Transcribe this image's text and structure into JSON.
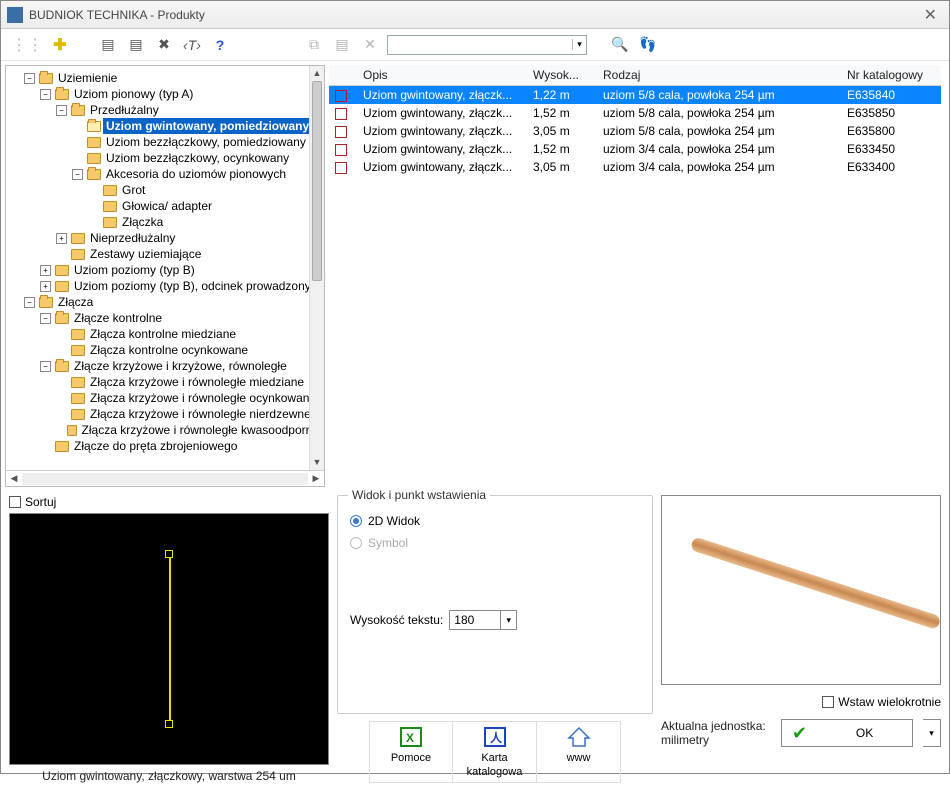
{
  "window": {
    "title": "BUDNIOK TECHNIKA - Produkty"
  },
  "toolbar": {
    "search_value": ""
  },
  "tree": {
    "root": "Uziemienie",
    "uziom_pionowy": "Uziom pionowy (typ A)",
    "przedluzalny": "Przedłużalny",
    "uziom_gwint": "Uziom gwintowany, pomiedziowany",
    "uziom_bezl_pom": "Uziom bezzłączkowy, pomiedziowany",
    "uziom_bezl_oc": "Uziom bezzłączkowy, ocynkowany",
    "akcesoria": "Akcesoria do uziomów pionowych",
    "grot": "Grot",
    "glowica": "Głowica/ adapter",
    "zlaczka": "Złączka",
    "nieprz": "Nieprzedłużalny",
    "zestawy": "Zestawy uziemiające",
    "poziomy_b": "Uziom poziomy (typ B)",
    "poziomy_b_od": "Uziom poziomy (typ B), odcinek prowadzony",
    "zlacza": "Złącza",
    "zlacze_kontr": "Złącze kontrolne",
    "zlacza_kontr_m": "Złącza kontrolne miedziane",
    "zlacza_kontr_o": "Złącza kontrolne ocynkowane",
    "zlacze_krz": "Złącze krzyżowe i krzyżowe, równoległe",
    "zlk_m": "Złącza krzyżowe i równoległe miedziane",
    "zlk_o": "Złącza krzyżowe i równoległe ocynkowane",
    "zlk_n": "Złącza krzyżowe i równoległe nierdzewne",
    "zlk_k": "Złącza krzyżowe i równoległe kwasoodporne",
    "zlacze_pret": "Złącze do pręta zbrojeniowego"
  },
  "table": {
    "headers": {
      "opis": "Opis",
      "wys": "Wysok...",
      "rodzaj": "Rodzaj",
      "nr": "Nr katalogowy"
    },
    "rows": [
      {
        "opis": "Uziom gwintowany, złączk...",
        "wys": "1,22 m",
        "rodzaj": "uziom 5/8 cala, powłoka 254 µm",
        "nr": "E635840",
        "sel": true
      },
      {
        "opis": "Uziom gwintowany, złączk...",
        "wys": "1,52 m",
        "rodzaj": "uziom 5/8 cala, powłoka 254 µm",
        "nr": "E635850",
        "sel": false
      },
      {
        "opis": "Uziom gwintowany, złączk...",
        "wys": "3,05 m",
        "rodzaj": "uziom 5/8 cala, powłoka 254 µm",
        "nr": "E635800",
        "sel": false
      },
      {
        "opis": "Uziom gwintowany, złączk...",
        "wys": "1,52 m",
        "rodzaj": "uziom 3/4 cala, powłoka 254 µm",
        "nr": "E633450",
        "sel": false
      },
      {
        "opis": "Uziom gwintowany, złączk...",
        "wys": "3,05 m",
        "rodzaj": "uziom 3/4 cala, powłoka 254 µm",
        "nr": "E633400",
        "sel": false
      }
    ]
  },
  "sort_label": "Sortuj",
  "preview_caption": "Uziom gwintowany, złączkowy, warstwa 254 um",
  "view_group": {
    "legend": "Widok i punkt wstawienia",
    "opt_2d": "2D Widok",
    "opt_symbol": "Symbol",
    "txtheight_label": "Wysokość tekstu:",
    "txtheight_value": "180"
  },
  "bottom_buttons": {
    "pomoce": "Pomoce",
    "karta": "Karta katalogowa",
    "www": "www"
  },
  "insert_multi": "Wstaw wielokrotnie",
  "unit_label": "Aktualna jednostka:",
  "unit_value": "milimetry",
  "ok_label": "OK"
}
